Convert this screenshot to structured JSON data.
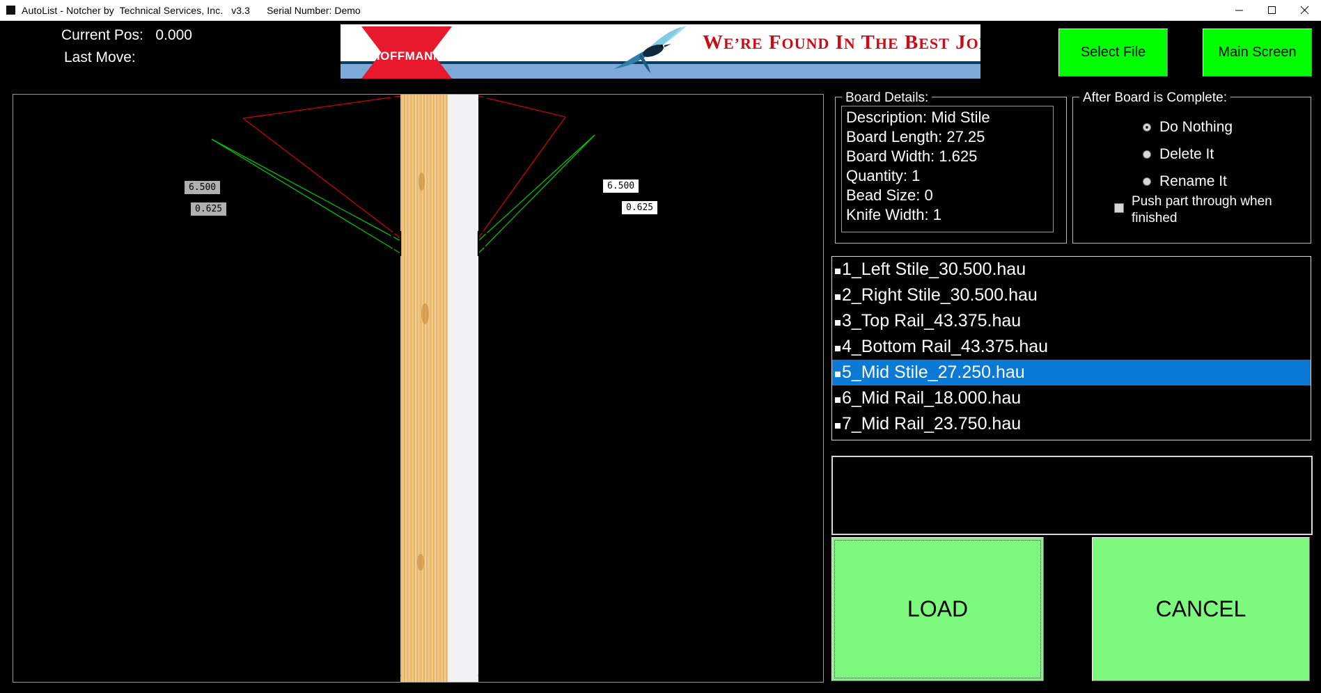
{
  "window": {
    "title": "AutoList - Notcher by  Technical Services, Inc.   v3.3",
    "serial": "Serial Number: Demo",
    "minimize_icon": "minimize-icon",
    "maximize_icon": "maximize-icon",
    "close_icon": "close-icon"
  },
  "header": {
    "current_pos": "Current Pos:   0.000",
    "last_move": "Last Move:",
    "select_file_label": "Select File",
    "main_screen_label": "Main Screen"
  },
  "banner": {
    "brand": "HOFFMANN",
    "slogan_parts": {
      "w": "W",
      "ere": "E’RE",
      "f": "F",
      "ound": "OUND",
      "i": "I",
      "n": "N",
      "t": "T",
      "he": "HE",
      "b": "B",
      "est": "EST",
      "j": "J",
      "oints": "OINTS!"
    },
    "slogan_full": "WE'RE FOUND IN THE BEST JOINTS!",
    "colors": {
      "red": "#cc0b17",
      "logo_red": "#e8192c",
      "band_blue": "#7da9d8"
    }
  },
  "diagram": {
    "labels": [
      {
        "text": "6.500",
        "style": "gray",
        "side": "left"
      },
      {
        "text": "0.625",
        "style": "gray",
        "side": "left"
      },
      {
        "text": "6.500",
        "style": "white",
        "side": "right"
      },
      {
        "text": "0.625",
        "style": "white",
        "side": "right"
      }
    ],
    "line_colors": {
      "red": "#d00000",
      "green": "#00c000"
    }
  },
  "board_details": {
    "legend": "Board Details:",
    "lines": [
      "Description: Mid Stile",
      "Board Length: 27.25",
      "Board Width: 1.625",
      "Quantity: 1",
      "Bead Size: 0",
      "Knife Width: 1"
    ]
  },
  "after_board": {
    "legend": "After Board is Complete:",
    "options": [
      {
        "label": "Do Nothing",
        "selected": true
      },
      {
        "label": "Delete It",
        "selected": false
      },
      {
        "label": "Rename It",
        "selected": false
      }
    ],
    "checkbox": {
      "label": "Push part through when\nfinished",
      "checked": false
    }
  },
  "file_list": {
    "items": [
      {
        "label": "1_Left Stile_30.500.hau",
        "selected": false
      },
      {
        "label": "2_Right Stile_30.500.hau",
        "selected": false
      },
      {
        "label": "3_Top Rail_43.375.hau",
        "selected": false
      },
      {
        "label": "4_Bottom Rail_43.375.hau",
        "selected": false
      },
      {
        "label": "5_Mid Stile_27.250.hau",
        "selected": true
      },
      {
        "label": "6_Mid Rail_18.000.hau",
        "selected": false
      },
      {
        "label": "7_Mid Rail_23.750.hau",
        "selected": false
      }
    ],
    "selection_color": "#0b7ad6"
  },
  "message_box": {
    "text": ""
  },
  "actions": {
    "load_label": "LOAD",
    "cancel_label": "CANCEL",
    "button_color": "#7dfa7d"
  }
}
